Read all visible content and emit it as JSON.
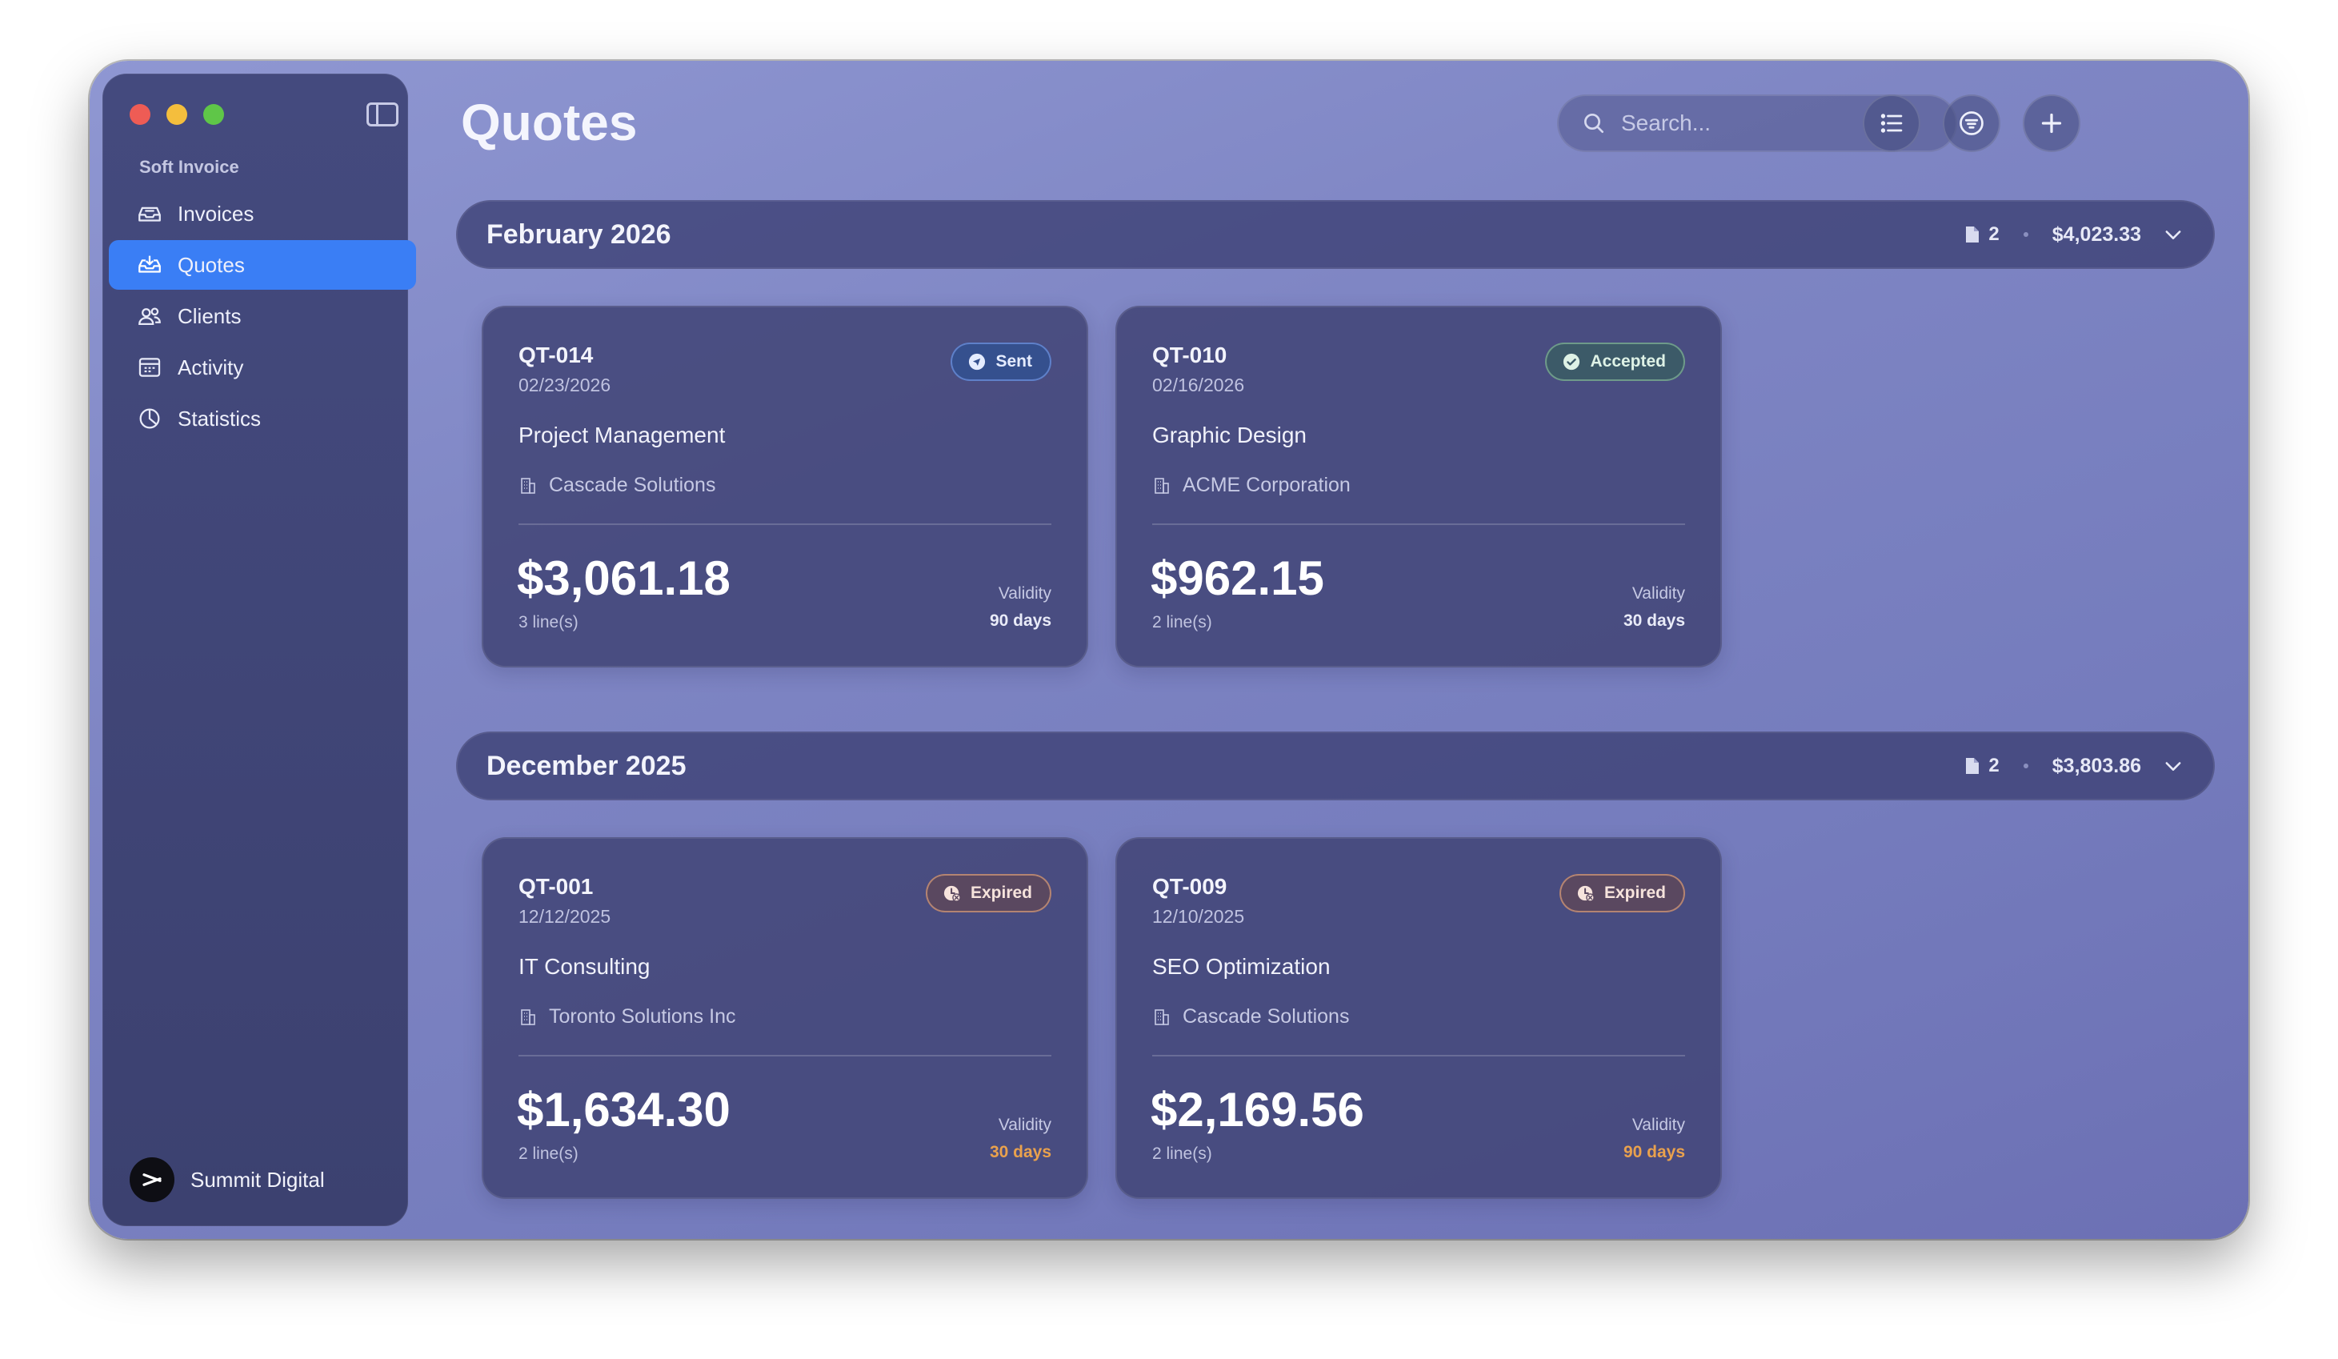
{
  "app": {
    "name": "Soft Invoice"
  },
  "sidebar": {
    "items": [
      {
        "label": "Invoices",
        "icon": "invoice-tray-icon",
        "active": false
      },
      {
        "label": "Quotes",
        "icon": "quote-tray-icon",
        "active": true
      },
      {
        "label": "Clients",
        "icon": "people-icon",
        "active": false
      },
      {
        "label": "Activity",
        "icon": "calendar-icon",
        "active": false
      },
      {
        "label": "Statistics",
        "icon": "pie-chart-icon",
        "active": false
      }
    ],
    "profile": {
      "name": "Summit Digital"
    }
  },
  "header": {
    "title": "Quotes",
    "search_placeholder": "Search...",
    "buttons": [
      "list-view-icon",
      "filter-icon",
      "plus-icon"
    ]
  },
  "groups": [
    {
      "title": "February 2026",
      "count": "2",
      "total": "$4,023.33",
      "quotes": [
        {
          "id": "QT-014",
          "date": "02/23/2026",
          "title": "Project Management",
          "client": "Cascade Solutions",
          "amount": "$3,061.18",
          "lines": "3 line(s)",
          "validity_label": "Validity",
          "validity": "90 days",
          "status": "Sent",
          "status_color": "#35508e"
        },
        {
          "id": "QT-010",
          "date": "02/16/2026",
          "title": "Graphic Design",
          "client": "ACME Corporation",
          "amount": "$962.15",
          "lines": "2 line(s)",
          "validity_label": "Validity",
          "validity": "30 days",
          "status": "Accepted",
          "status_color": "#3c5a68"
        }
      ]
    },
    {
      "title": "December 2025",
      "count": "2",
      "total": "$3,803.86",
      "quotes": [
        {
          "id": "QT-001",
          "date": "12/12/2025",
          "title": "IT Consulting",
          "client": "Toronto Solutions Inc",
          "amount": "$1,634.30",
          "lines": "2 line(s)",
          "validity_label": "Validity",
          "validity": "30 days",
          "status": "Expired",
          "status_color": "#5a4860"
        },
        {
          "id": "QT-009",
          "date": "12/10/2025",
          "title": "SEO Optimization",
          "client": "Cascade Solutions",
          "amount": "$2,169.56",
          "lines": "2 line(s)",
          "validity_label": "Validity",
          "validity": "90 days",
          "status": "Expired",
          "status_color": "#5a4860"
        }
      ]
    }
  ],
  "colors": {
    "accent": "#3a7ef5",
    "expired_validity": "#e9a14d"
  }
}
